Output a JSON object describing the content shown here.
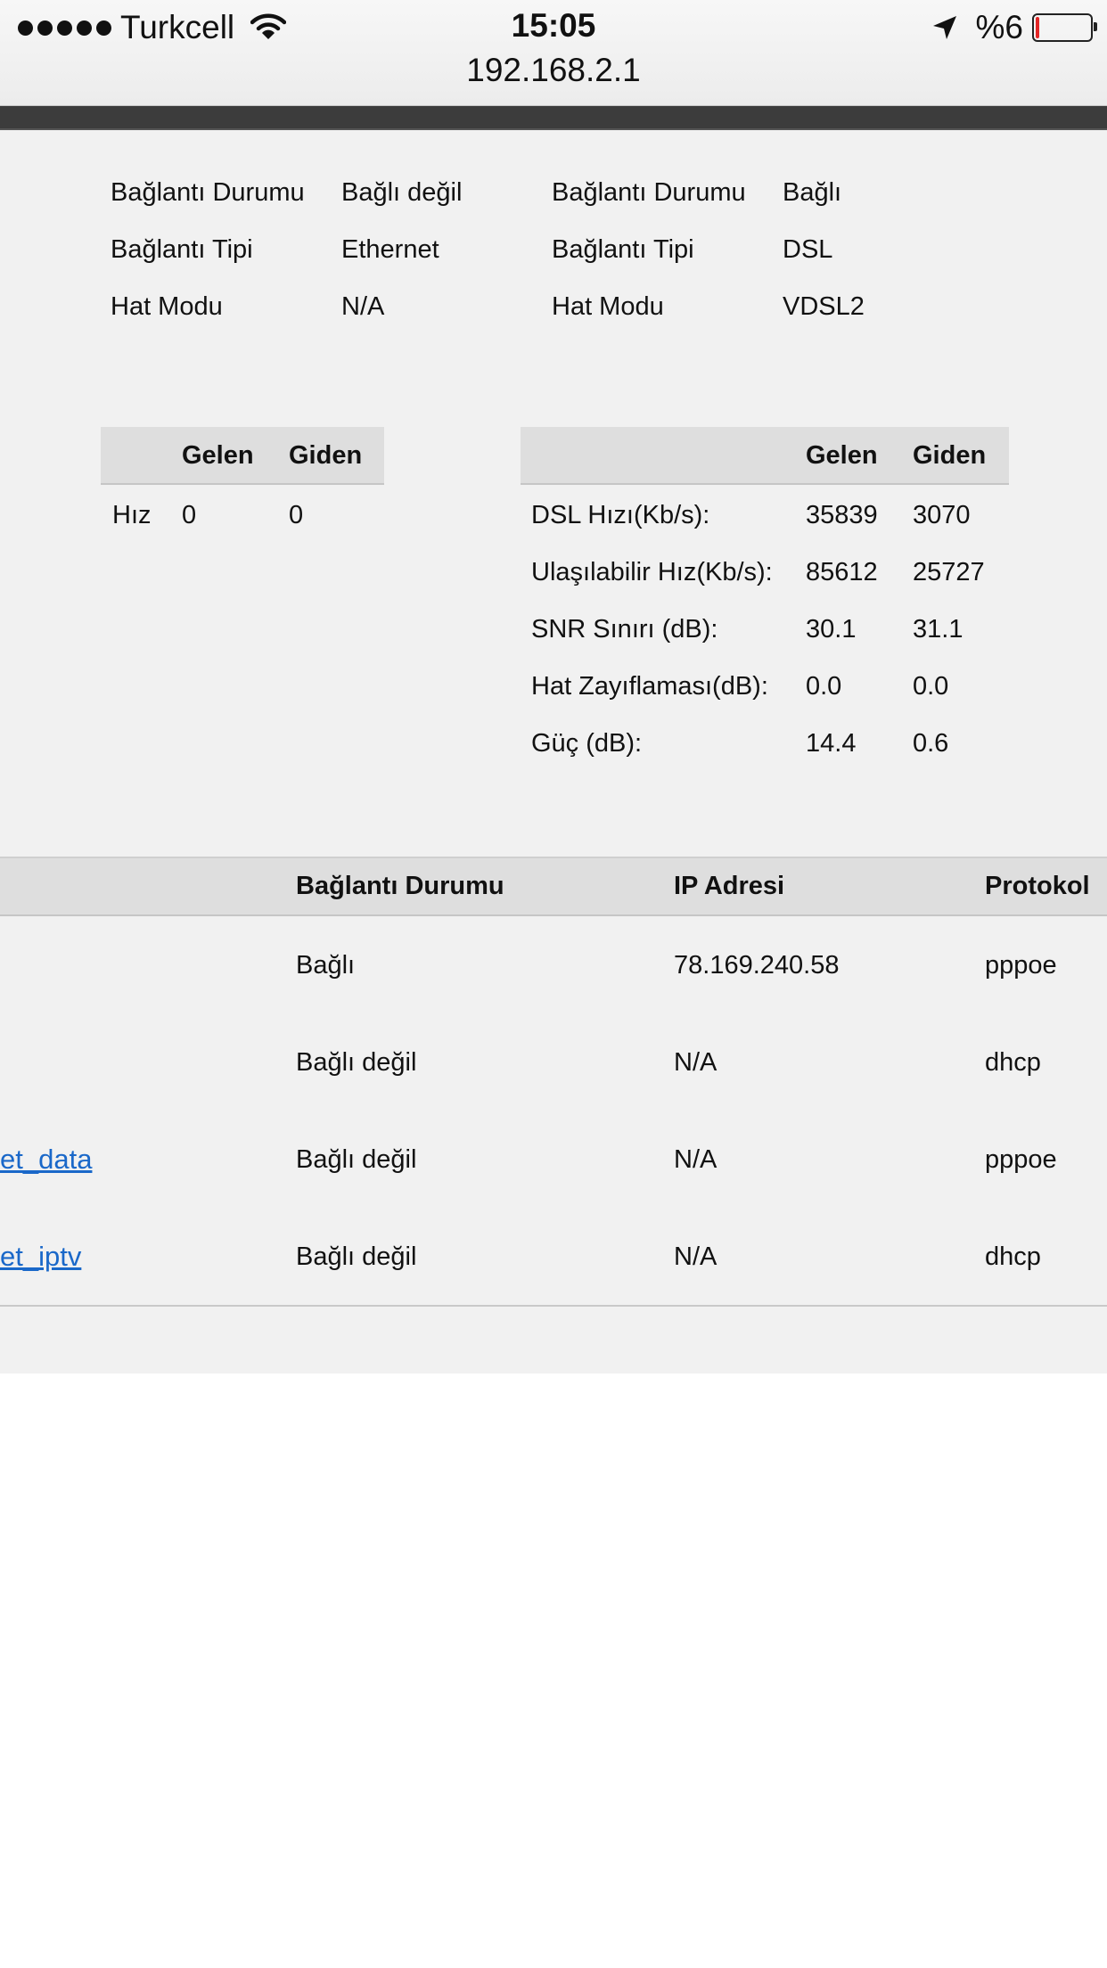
{
  "status_bar": {
    "carrier": "Turkcell",
    "time": "15:05",
    "battery": "%6",
    "battery_level": 0.06,
    "url": "192.168.2.1",
    "icons": [
      "signal-dots-icon",
      "wifi-icon",
      "location-arrow-icon",
      "battery-icon"
    ]
  },
  "ethernet": {
    "rows": [
      {
        "label": "Bağlantı Durumu",
        "value": "Bağlı değil"
      },
      {
        "label": "Bağlantı Tipi",
        "value": "Ethernet"
      },
      {
        "label": "Hat Modu",
        "value": "N/A"
      }
    ],
    "table": {
      "headers": [
        "",
        "Gelen",
        "Giden"
      ],
      "rows": [
        [
          "Hız",
          "0",
          "0"
        ]
      ]
    }
  },
  "dsl": {
    "rows": [
      {
        "label": "Bağlantı Durumu",
        "value": "Bağlı"
      },
      {
        "label": "Bağlantı Tipi",
        "value": "DSL"
      },
      {
        "label": "Hat Modu",
        "value": "VDSL2"
      }
    ],
    "table": {
      "headers": [
        "",
        "Gelen",
        "Giden"
      ],
      "rows": [
        [
          "DSL Hızı(Kb/s):",
          "35839",
          "3070"
        ],
        [
          "Ulaşılabilir Hız(Kb/s):",
          "85612",
          "25727"
        ],
        [
          "SNR Sınırı (dB):",
          "30.1",
          "31.1"
        ],
        [
          "Hat Zayıflaması(dB):",
          "0.0",
          "0.0"
        ],
        [
          "Güç (dB):",
          "14.4",
          "0.6"
        ]
      ]
    }
  },
  "connections": {
    "headers": [
      "",
      "Bağlantı Durumu",
      "IP Adresi",
      "Protokol"
    ],
    "rows": [
      {
        "name": "",
        "status": "Bağlı",
        "ip": "78.169.240.58",
        "protocol": "pppoe"
      },
      {
        "name": "",
        "status": "Bağlı değil",
        "ip": "N/A",
        "protocol": "dhcp"
      },
      {
        "name": "et_data",
        "status": "Bağlı değil",
        "ip": "N/A",
        "protocol": "pppoe"
      },
      {
        "name": "et_iptv",
        "status": "Bağlı değil",
        "ip": "N/A",
        "protocol": "dhcp"
      }
    ]
  }
}
